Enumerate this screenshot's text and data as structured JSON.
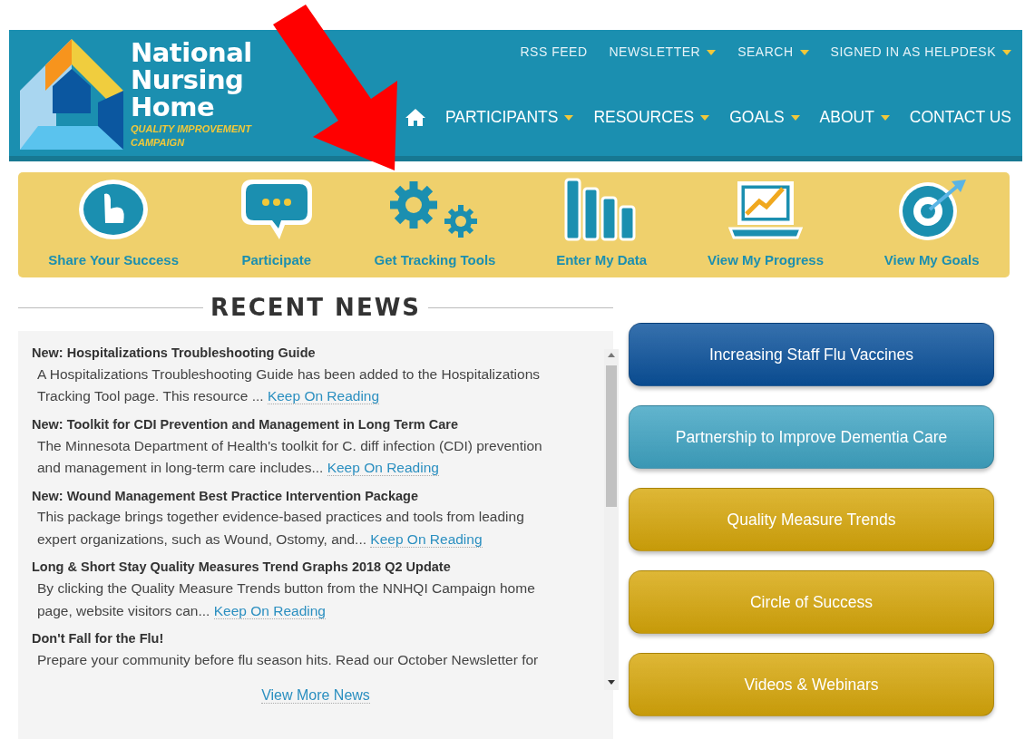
{
  "header": {
    "logo": {
      "title_lines": [
        "National",
        "Nursing",
        "Home"
      ],
      "subtitle_lines": [
        "QUALITY IMPROVEMENT",
        "CAMPAIGN"
      ]
    },
    "top_links": [
      {
        "label": "RSS FEED",
        "dropdown": false
      },
      {
        "label": "NEWSLETTER",
        "dropdown": true
      },
      {
        "label": "SEARCH",
        "dropdown": true
      },
      {
        "label": "SIGNED IN AS HELPDESK",
        "dropdown": true
      }
    ],
    "main_nav": [
      {
        "label": "PARTICIPANTS",
        "dropdown": true
      },
      {
        "label": "RESOURCES",
        "dropdown": true
      },
      {
        "label": "GOALS",
        "dropdown": true
      },
      {
        "label": "ABOUT",
        "dropdown": true
      },
      {
        "label": "CONTACT US",
        "dropdown": false
      }
    ]
  },
  "quick_links": [
    {
      "label": "Share Your Success",
      "kind": "hand"
    },
    {
      "label": "Participate",
      "kind": "chat"
    },
    {
      "label": "Get Tracking Tools",
      "kind": "gears"
    },
    {
      "label": "Enter My Data",
      "kind": "bars"
    },
    {
      "label": "View My Progress",
      "kind": "laptop"
    },
    {
      "label": "View My Goals",
      "kind": "target"
    }
  ],
  "news": {
    "heading": "RECENT NEWS",
    "items": [
      {
        "title": "New: Hospitalizations Troubleshooting Guide",
        "summary": "A Hospitalizations Troubleshooting Guide has been added to the Hospitalizations Tracking Tool page. This resource ...",
        "link": "Keep On Reading"
      },
      {
        "title": "New: Toolkit for CDI Prevention and Management in Long Term Care",
        "summary": "The Minnesota Department of Health's toolkit for C. diff infection (CDI) prevention and management in long-term care includes...",
        "link": "Keep On Reading"
      },
      {
        "title": "New: Wound Management Best Practice Intervention Package",
        "summary": "This package brings together evidence-based practices and tools from leading expert organizations, such as Wound, Ostomy, and...",
        "link": "Keep On Reading"
      },
      {
        "title": "Long & Short Stay Quality Measures Trend Graphs 2018 Q2 Update",
        "summary": "By clicking the Quality Measure Trends button from the NNHQI Campaign home page, website visitors can...",
        "link": "Keep On Reading"
      },
      {
        "title": "Don't Fall for the Flu!",
        "summary": "Prepare your community before flu season hits. Read our October Newsletter for"
      }
    ],
    "more_link": "View More News"
  },
  "feature_buttons": [
    {
      "label": "Increasing Staff Flu Vaccines",
      "color": "#0a519b"
    },
    {
      "label": "Partnership to Improve Dementia Care",
      "color": "#3fa4c3"
    },
    {
      "label": "Quality Measure Trends",
      "color": "#d7a70a"
    },
    {
      "label": "Circle of Success",
      "color": "#d7a70a"
    },
    {
      "label": "Videos & Webinars",
      "color": "#d7a70a"
    }
  ]
}
